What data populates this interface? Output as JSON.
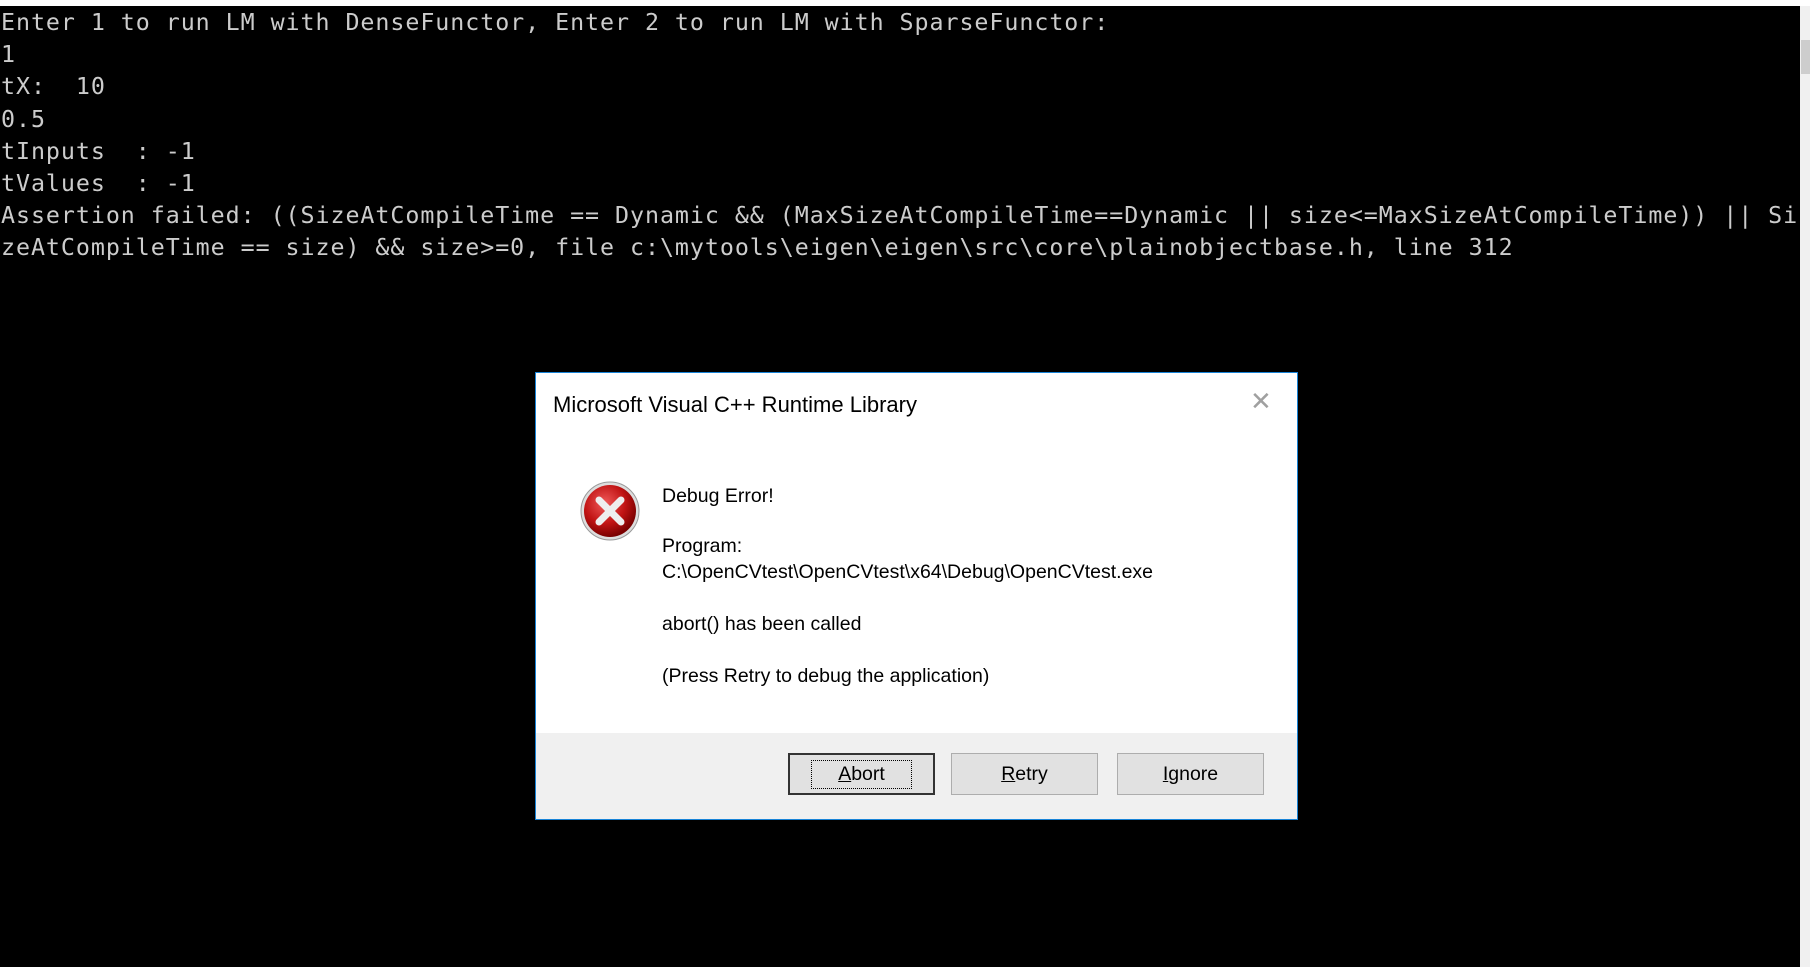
{
  "console": {
    "lines": [
      "Enter 1 to run LM with DenseFunctor, Enter 2 to run LM with SparseFunctor:",
      "1",
      "tX:  10",
      "0.5",
      "tInputs  : -1",
      "tValues  : -1",
      "Assertion failed: ((SizeAtCompileTime == Dynamic && (MaxSizeAtCompileTime==Dynamic || size<=MaxSizeAtCompileTime)) || Si",
      "zeAtCompileTime == size) && size>=0, file c:\\mytools\\eigen\\eigen\\src\\core\\plainobjectbase.h, line 312"
    ]
  },
  "dialog": {
    "title": "Microsoft Visual C++ Runtime Library",
    "close_icon": "close-icon",
    "icon": "error-icon",
    "heading": "Debug Error!",
    "program_label": "Program:",
    "program_path": "C:\\OpenCVtest\\OpenCVtest\\x64\\Debug\\OpenCVtest.exe",
    "message": "abort() has been called",
    "hint": "(Press Retry to debug the application)",
    "buttons": {
      "abort": {
        "mnemonic": "A",
        "rest": "bort"
      },
      "retry": {
        "mnemonic": "R",
        "rest": "etry"
      },
      "ignore": {
        "mnemonic": "I",
        "rest": "gnore"
      }
    },
    "accent_color": "#1883d7"
  }
}
